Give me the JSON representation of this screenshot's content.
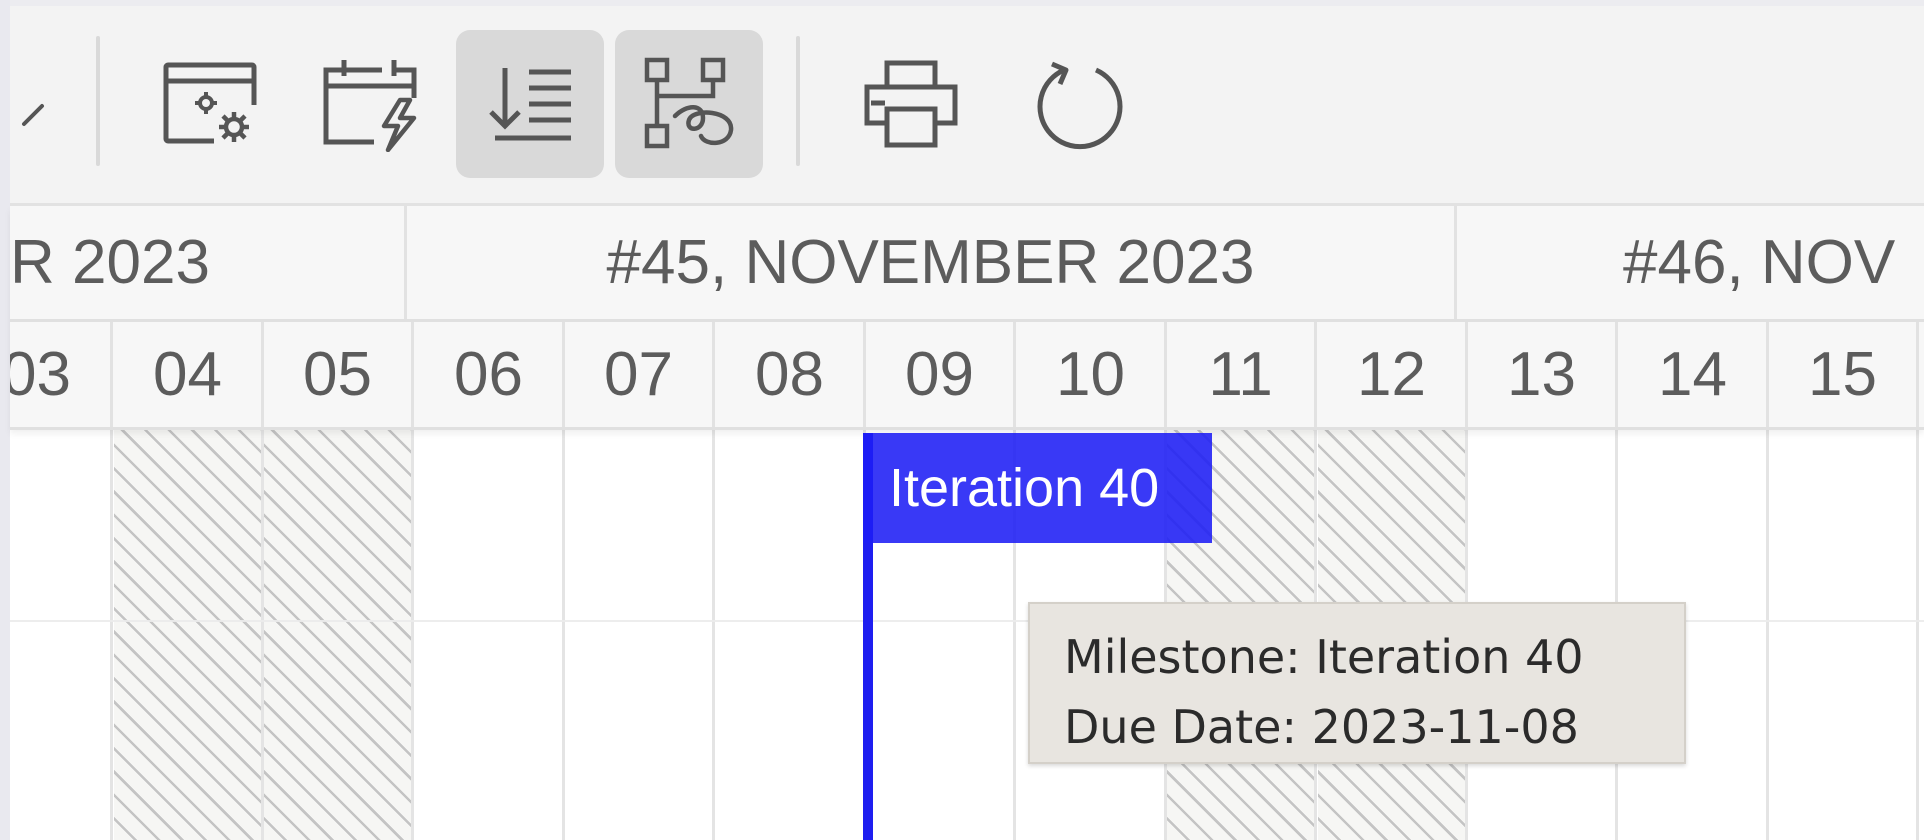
{
  "toolbar": {
    "buttons": [
      {
        "icon": "calendar-settings-icon",
        "active": false
      },
      {
        "icon": "calendar-lightning-icon",
        "active": false
      },
      {
        "icon": "sort-indent-icon",
        "active": true
      },
      {
        "icon": "dependency-tree-icon",
        "active": true
      },
      {
        "icon": "printer-icon",
        "active": false
      },
      {
        "icon": "refresh-icon",
        "active": false
      }
    ]
  },
  "timeline": {
    "weeks": [
      {
        "label": "R 2023"
      },
      {
        "label": "#45, NOVEMBER 2023"
      },
      {
        "label": "#46, NOV"
      }
    ],
    "days": [
      {
        "label": "03",
        "weekend": false
      },
      {
        "label": "04",
        "weekend": true
      },
      {
        "label": "05",
        "weekend": true
      },
      {
        "label": "06",
        "weekend": false
      },
      {
        "label": "07",
        "weekend": false
      },
      {
        "label": "08",
        "weekend": false
      },
      {
        "label": "09",
        "weekend": false
      },
      {
        "label": "10",
        "weekend": false
      },
      {
        "label": "11",
        "weekend": true
      },
      {
        "label": "12",
        "weekend": true
      },
      {
        "label": "13",
        "weekend": false
      },
      {
        "label": "14",
        "weekend": false
      },
      {
        "label": "15",
        "weekend": false
      }
    ]
  },
  "milestone": {
    "label": "Iteration 40",
    "color": "#1e1ef0"
  },
  "tooltip": {
    "line1": "Milestone: Iteration 40",
    "line2": "Due Date: 2023-11-08"
  }
}
